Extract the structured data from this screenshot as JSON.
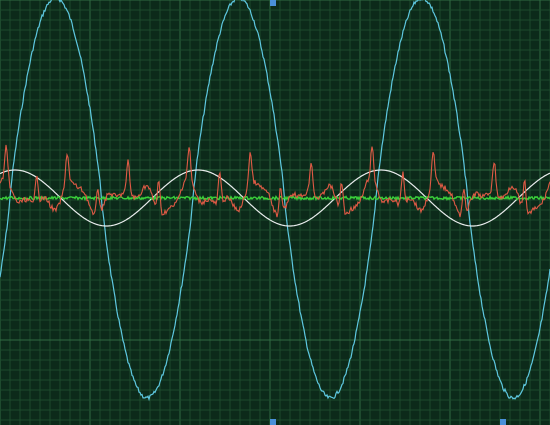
{
  "colors": {
    "background": "#0c2a1a",
    "grid_minor": "#1d4a2c",
    "grid_major": "#2f6b42",
    "trace_cyan": "#5ec8e0",
    "trace_red": "#e05a45",
    "trace_white": "#e8ecec",
    "trace_green": "#3ad13a",
    "marker": "#4a90d9"
  },
  "chart_data": {
    "type": "line",
    "x_range": [
      0,
      550
    ],
    "y_range": [
      -1.0,
      1.0
    ],
    "grid": true,
    "series": [
      {
        "color": "#5ec8e0",
        "shape": "sine, slightly flattened peaks with noise",
        "cycles": 2.9,
        "amplitude": 0.93,
        "offset": 0.0
      },
      {
        "color": "#e8ecec",
        "shape": "sine",
        "cycles": 3.0,
        "amplitude": 0.13,
        "offset": 0.0
      },
      {
        "color": "#e05a45",
        "shape": "harmonic ripple",
        "cycles": 9.0,
        "amplitude": 0.12,
        "offset": 0.0
      },
      {
        "color": "#3ad13a",
        "shape": "flat with noise",
        "cycles": 0,
        "amplitude": 0.01,
        "offset": 0.02
      }
    ]
  }
}
